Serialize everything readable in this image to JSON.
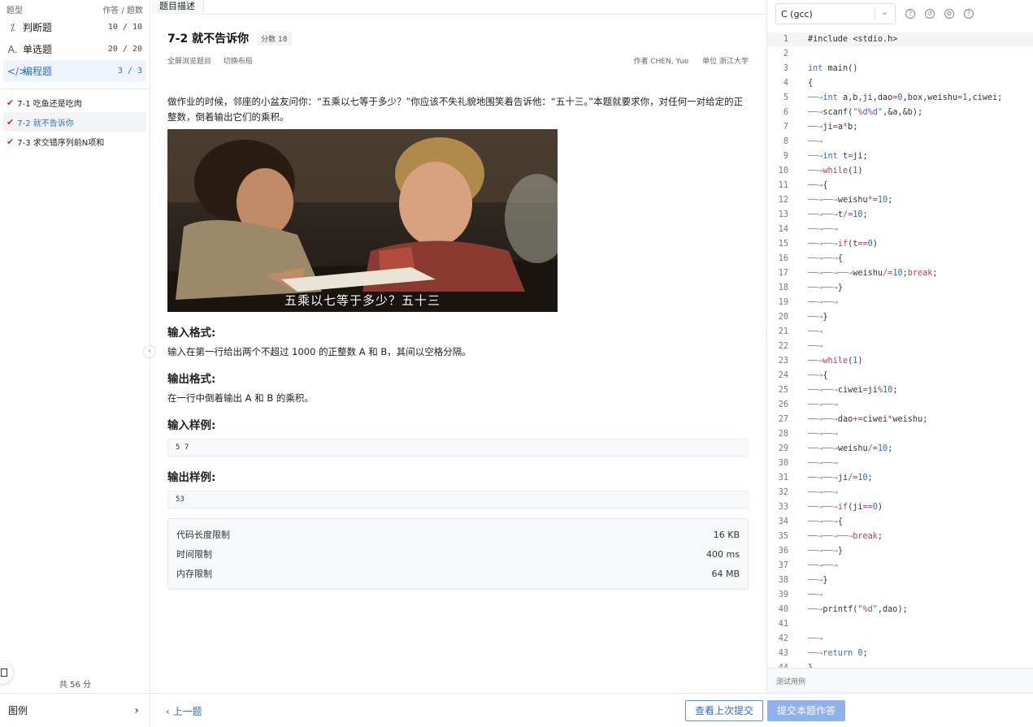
{
  "sidebar": {
    "col_type": "题型",
    "col_count": "作答 / 题数",
    "types": [
      {
        "icon": "true-false-icon",
        "glyph": "⁒",
        "label": "判断题",
        "count": "10 / 10",
        "active": false
      },
      {
        "icon": "single-choice-icon",
        "glyph": "A.",
        "label": "单选题",
        "count": "20 / 20",
        "active": false
      },
      {
        "icon": "code-icon",
        "glyph": "</>",
        "label": "编程题",
        "count": "3 / 3",
        "active": true
      }
    ],
    "problems": [
      {
        "label": "7-1 吃鱼还是吃肉",
        "active": false
      },
      {
        "label": "7-2 就不告诉你",
        "active": true
      },
      {
        "label": "7-3 求交错序列前N项和",
        "active": false
      }
    ],
    "total": "共 56 分",
    "legend": "图例"
  },
  "tabs": [
    "题目描述"
  ],
  "problem": {
    "title": "7-2 就不告诉你",
    "score": "分数 18",
    "links": [
      "全屏浏览题目",
      "切换布局"
    ],
    "author": "作者 CHEN, Yue",
    "unit": "单位 浙江大学",
    "description": "做作业的时候，邻座的小盆友问你：“五乘以七等于多少？”你应该不失礼貌地围笑着告诉他：“五十三。”本题就要求你，对任何一对给定的正整数，倒着输出它们的乘积。",
    "image_caption": "五乘以七等于多少？五十三",
    "input_title": "输入格式:",
    "input_text": "输入在第一行给出两个不超过 1000 的正整数 A 和 B，其间以空格分隔。",
    "output_title": "输出格式:",
    "output_text": "在一行中倒着输出 A 和 B 的乘积。",
    "sample_in_title": "输入样例:",
    "sample_in": "5 7",
    "sample_out_title": "输出样例:",
    "sample_out": "53",
    "limits": [
      {
        "label": "代码长度限制",
        "value": "16 KB"
      },
      {
        "label": "时间限制",
        "value": "400 ms"
      },
      {
        "label": "内存限制",
        "value": "64 MB"
      }
    ]
  },
  "bottom": {
    "prev": "上一题",
    "view_last": "查看上次提交",
    "submit": "提交本题作答"
  },
  "editor": {
    "language": "C (gcc)",
    "toolbar_icons": [
      "help-icon",
      "history-icon",
      "settings-icon",
      "info-icon"
    ],
    "testcase_label": "测试用例",
    "lines": [
      "#include <stdio.h>",
      "",
      "int main()",
      "{",
      "\tint a,b,ji,dao=0,box,weishu=1,ciwei;",
      "\tscanf(\"%d%d\",&a,&b);",
      "\tji=a*b;",
      "\t",
      "\tint t=ji;",
      "\twhile(1)",
      "\t{",
      "\t\tweishu*=10;",
      "\t\tt/=10;",
      "\t\t",
      "\t\tif(t==0)",
      "\t\t{",
      "\t\t\tweishu/=10;break;",
      "\t\t}",
      "\t\t",
      "\t}",
      "\t",
      "\t",
      "\twhile(1)",
      "\t{",
      "\t\tciwei=ji%10;",
      "\t\t",
      "\t\tdao+=ciwei*weishu;",
      "\t\t",
      "\t\tweishu/=10;",
      "\t\t",
      "\t\tji/=10;",
      "\t\t",
      "\t\tif(ji==0)",
      "\t\t{",
      "\t\t\tbreak;",
      "\t\t}",
      "\t\t",
      "\t}",
      "\t",
      "\tprintf(\"%d\",dao);",
      "",
      "\t",
      "\treturn 0;",
      "}"
    ]
  }
}
